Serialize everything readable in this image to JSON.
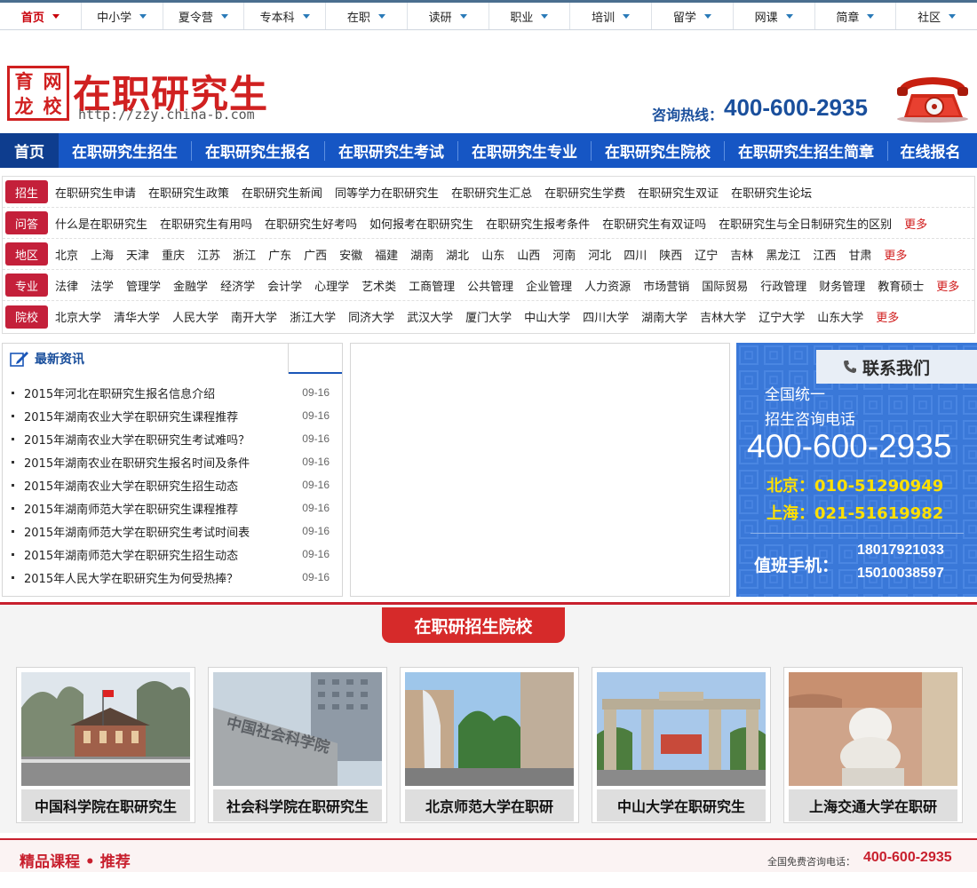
{
  "topnav": [
    {
      "label": "首页",
      "active": true
    },
    {
      "label": "中小学"
    },
    {
      "label": "夏令营"
    },
    {
      "label": "专本科"
    },
    {
      "label": "在职"
    },
    {
      "label": "读研"
    },
    {
      "label": "职业"
    },
    {
      "label": "培训"
    },
    {
      "label": "留学"
    },
    {
      "label": "网课"
    },
    {
      "label": "简章"
    },
    {
      "label": "社区"
    }
  ],
  "header": {
    "logo_chars": [
      "育",
      "网",
      "龙",
      "校"
    ],
    "logo_title": "在职研究生",
    "logo_url": "http://zzy.china-b.com",
    "hotline_label": "咨询热线：",
    "hotline_number": "400-600-2935"
  },
  "mainnav": [
    "首页",
    "在职研究生招生",
    "在职研究生报名",
    "在职研究生考试",
    "在职研究生专业",
    "在职研究生院校",
    "在职研究生招生简章",
    "在线报名"
  ],
  "categories": [
    {
      "tag": "招生",
      "links": [
        "在职研究生申请",
        "在职研究生政策",
        "在职研究生新闻",
        "同等学力在职研究生",
        "在职研究生汇总",
        "在职研究生学费",
        "在职研究生双证",
        "在职研究生论坛"
      ],
      "more": ""
    },
    {
      "tag": "问答",
      "links": [
        "什么是在职研究生",
        "在职研究生有用吗",
        "在职研究生好考吗",
        "如何报考在职研究生",
        "在职研究生报考条件",
        "在职研究生有双证吗",
        "在职研究生与全日制研究生的区别"
      ],
      "more": "更多"
    },
    {
      "tag": "地区",
      "links": [
        "北京",
        "上海",
        "天津",
        "重庆",
        "江苏",
        "浙江",
        "广东",
        "广西",
        "安徽",
        "福建",
        "湖南",
        "湖北",
        "山东",
        "山西",
        "河南",
        "河北",
        "四川",
        "陕西",
        "辽宁",
        "吉林",
        "黑龙江",
        "江西",
        "甘肃"
      ],
      "more": "更多"
    },
    {
      "tag": "专业",
      "links": [
        "法律",
        "法学",
        "管理学",
        "金融学",
        "经济学",
        "会计学",
        "心理学",
        "艺术类",
        "工商管理",
        "公共管理",
        "企业管理",
        "人力资源",
        "市场营销",
        "国际贸易",
        "行政管理",
        "财务管理",
        "教育硕士"
      ],
      "more": "更多"
    },
    {
      "tag": "院校",
      "links": [
        "北京大学",
        "清华大学",
        "人民大学",
        "南开大学",
        "浙江大学",
        "同济大学",
        "武汉大学",
        "厦门大学",
        "中山大学",
        "四川大学",
        "湖南大学",
        "吉林大学",
        "辽宁大学",
        "山东大学"
      ],
      "more": "更多"
    }
  ],
  "news": {
    "title": "最新资讯",
    "items": [
      {
        "title": "2015年河北在职研究生报名信息介绍",
        "date": "09-16"
      },
      {
        "title": "2015年湖南农业大学在职研究生课程推荐",
        "date": "09-16"
      },
      {
        "title": "2015年湖南农业大学在职研究生考试难吗？",
        "date": "09-16"
      },
      {
        "title": "2015年湖南农业在职研究生报名时间及条件",
        "date": "09-16"
      },
      {
        "title": "2015年湖南农业大学在职研究生招生动态",
        "date": "09-16"
      },
      {
        "title": "2015年湖南师范大学在职研究生课程推荐",
        "date": "09-16"
      },
      {
        "title": "2015年湖南师范大学在职研究生考试时间表",
        "date": "09-16"
      },
      {
        "title": "2015年湖南师范大学在职研究生招生动态",
        "date": "09-16"
      },
      {
        "title": "2015年人民大学在职研究生为何受热捧？",
        "date": "09-16"
      }
    ]
  },
  "contact": {
    "title": "联系我们",
    "line1": "全国统一",
    "line2": "招生咨询电话",
    "phone": "400-600-2935",
    "beijing": "北京：010-51290949",
    "shanghai": "上海：021-51619982",
    "mobile_label": "值班手机：",
    "mobile1": "18017921033",
    "mobile2": "15010038597"
  },
  "schools": {
    "banner": "在职研招生院校",
    "items": [
      {
        "caption": "中国科学院在职研究生"
      },
      {
        "caption": "社会科学院在职研究生",
        "sign": "中国社会科学院"
      },
      {
        "caption": "北京师范大学在职研"
      },
      {
        "caption": "中山大学在职研究生"
      },
      {
        "caption": "上海交通大学在职研"
      }
    ]
  },
  "bottom": {
    "title": "精品课程 • 推荐",
    "label": "全国免费咨询电话：",
    "phone": "400-600-2935"
  },
  "colors": {
    "brand_red": "#d02020",
    "nav_blue": "#1656c4",
    "contact_blue": "#3a78d8",
    "tag_red": "#c4203a"
  }
}
